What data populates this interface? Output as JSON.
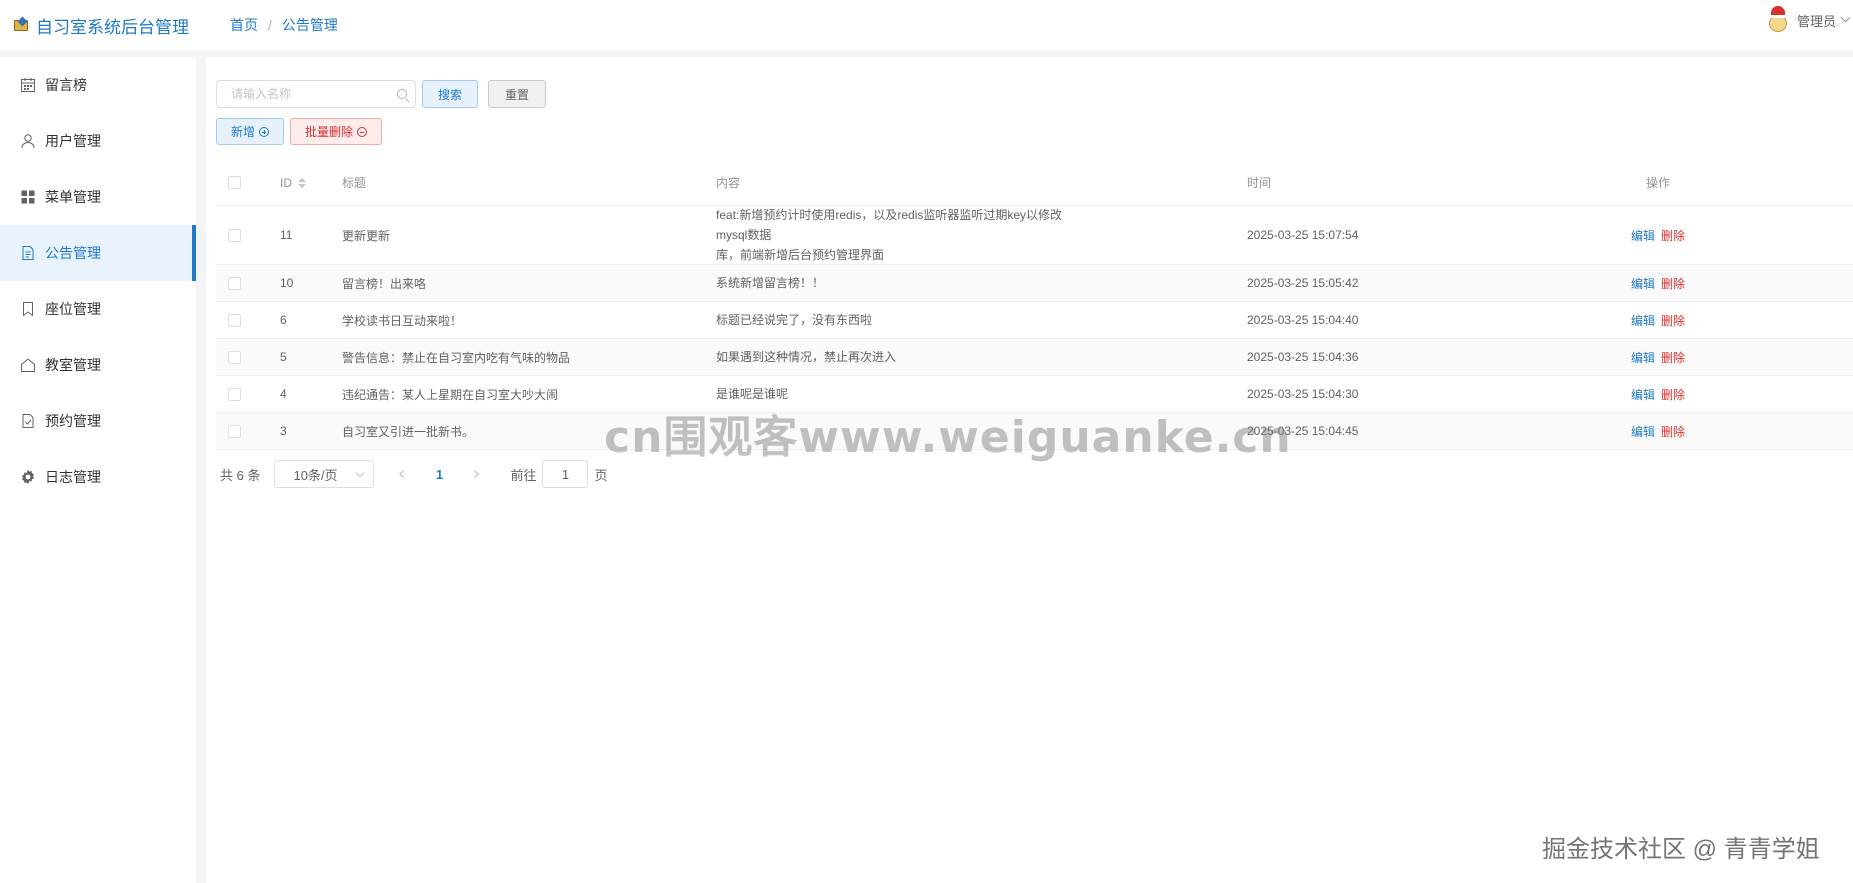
{
  "app": {
    "title": "自习室系统后台管理"
  },
  "breadcrumb": {
    "home": "首页",
    "separator": "/",
    "current": "公告管理"
  },
  "user": {
    "name": "管理员"
  },
  "sidebar": {
    "items": [
      {
        "label": "留言榜",
        "icon": "calendar-icon"
      },
      {
        "label": "用户管理",
        "icon": "user-icon"
      },
      {
        "label": "菜单管理",
        "icon": "grid-icon"
      },
      {
        "label": "公告管理",
        "icon": "document-icon",
        "active": true
      },
      {
        "label": "座位管理",
        "icon": "bookmark-icon"
      },
      {
        "label": "教室管理",
        "icon": "house-icon"
      },
      {
        "label": "预约管理",
        "icon": "checklist-icon"
      },
      {
        "label": "日志管理",
        "icon": "gear-icon"
      }
    ]
  },
  "toolbar": {
    "search_placeholder": "请输入名称",
    "search_value": "",
    "search_label": "搜索",
    "reset_label": "重置",
    "add_label": "新增",
    "batch_delete_label": "批量删除"
  },
  "table": {
    "headers": {
      "id": "ID",
      "title": "标题",
      "content": "内容",
      "time": "时间",
      "op": "操作"
    },
    "rows": [
      {
        "id": "11",
        "title": "更新更新",
        "content_line1": "feat:新增预约计时使用redis，以及redis监听器监听过期key以修改mysql数据",
        "content_line2": "库，前端新增后台预约管理界面",
        "time": "2025-03-25 15:07:54"
      },
      {
        "id": "10",
        "title": "留言榜！出来咯",
        "content_line1": "系统新增留言榜！！",
        "content_line2": "",
        "time": "2025-03-25 15:05:42"
      },
      {
        "id": "6",
        "title": "学校读书日互动来啦！",
        "content_line1": "标题已经说完了，没有东西啦",
        "content_line2": "",
        "time": "2025-03-25 15:04:40"
      },
      {
        "id": "5",
        "title": "警告信息：禁止在自习室内吃有气味的物品",
        "content_line1": "如果遇到这种情况，禁止再次进入",
        "content_line2": "",
        "time": "2025-03-25 15:04:36"
      },
      {
        "id": "4",
        "title": "违纪通告：某人上星期在自习室大吵大闹",
        "content_line1": "是谁呢是谁呢",
        "content_line2": "",
        "time": "2025-03-25 15:04:30"
      },
      {
        "id": "3",
        "title": "自习室又引进一批新书。",
        "content_line1": "",
        "content_line2": "",
        "time": "2025-03-25 15:04:45"
      }
    ],
    "edit_label": "编辑",
    "delete_label": "删除"
  },
  "pagination": {
    "total_text": "共 6 条",
    "page_size": "10条/页",
    "current_page": "1",
    "goto_label": "前往",
    "goto_value": "1",
    "page_unit": "页"
  },
  "watermarks": {
    "center": "cn围观客www.weiguanke.cn",
    "corner": "掘金技术社区 @ 青青学姐"
  },
  "colors": {
    "accent": "#1e7ac7",
    "danger": "#d6302f",
    "active_bg": "#e8f3fd"
  }
}
